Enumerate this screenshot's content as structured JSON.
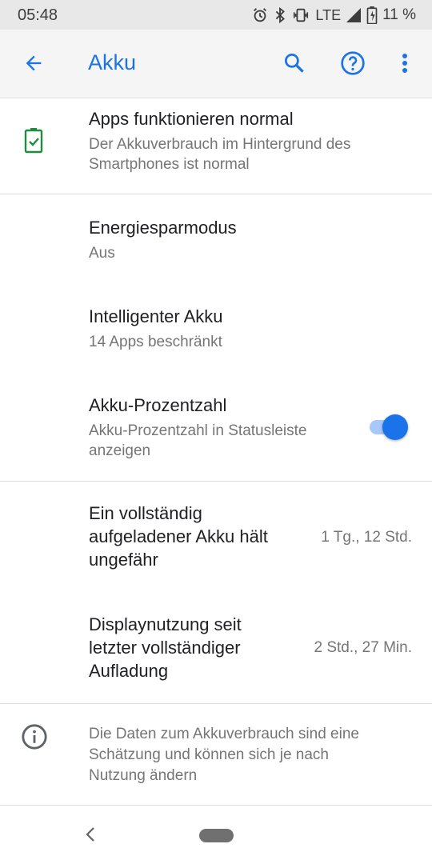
{
  "status_bar": {
    "time": "05:48",
    "network": "LTE",
    "battery_percent": "11 %",
    "icons": [
      "alarm-icon",
      "bluetooth-icon",
      "vibrate-icon",
      "signal-icon",
      "battery-charging-icon"
    ]
  },
  "app_bar": {
    "title": "Akku",
    "accent_color": "#1a73e8",
    "icons": [
      "back-arrow-icon",
      "search-icon",
      "help-icon",
      "more-vert-icon"
    ]
  },
  "battery_status": {
    "icon": "battery-check-icon",
    "icon_color": "#1e8e3e",
    "title": "Apps funktionieren normal",
    "subtitle_line1": "Der Akkuverbrauch im Hintergrund des",
    "subtitle_line2": "Smartphones ist normal"
  },
  "settings": {
    "battery_saver": {
      "title": "Energiesparmodus",
      "subtitle": "Aus"
    },
    "adaptive_battery": {
      "title": "Intelligenter Akku",
      "subtitle": "14 Apps beschränkt"
    },
    "battery_percentage": {
      "title": "Akku-Prozentzahl",
      "subtitle_line1": "Akku-Prozentzahl in Statusleiste",
      "subtitle_line2": "anzeigen",
      "enabled": true
    }
  },
  "usage": {
    "full_charge": {
      "title_line1": "Ein vollständig",
      "title_line2": "aufgeladener Akku hält",
      "title_line3": "ungefähr",
      "value": "1 Tg., 12 Std."
    },
    "screen_usage": {
      "title_line1": "Displaynutzung seit",
      "title_line2": "letzter vollständiger",
      "title_line3": "Aufladung",
      "value": "2 Std., 27 Min."
    }
  },
  "info": {
    "icon": "info-icon",
    "line1": "Die Daten zum Akkuverbrauch sind eine",
    "line2": "Schätzung und können sich je nach",
    "line3": "Nutzung ändern"
  },
  "nav_bar": {
    "icons": [
      "nav-back-icon",
      "home-pill-icon"
    ]
  }
}
